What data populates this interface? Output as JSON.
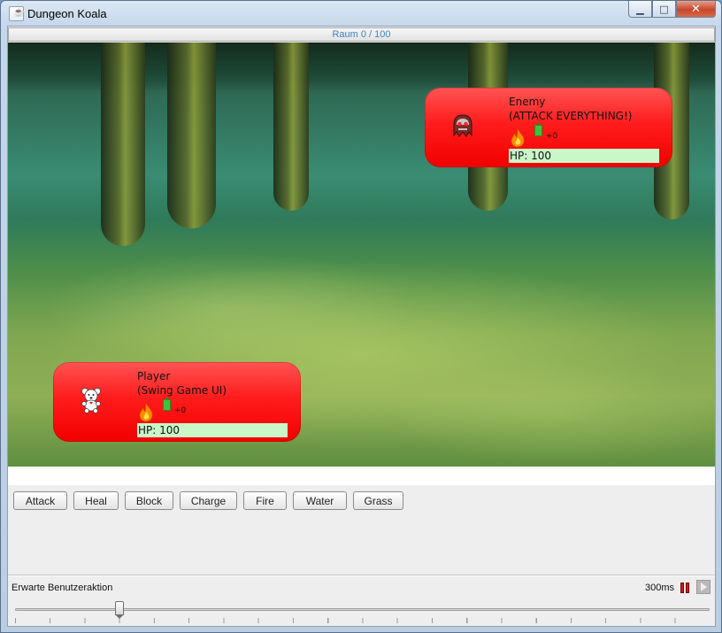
{
  "window": {
    "title": "Dungeon Koala",
    "icon": "java-cup-icon"
  },
  "window_controls": {
    "minimize": "minimize-icon",
    "maximize": "maximize-icon",
    "close": "close-icon"
  },
  "progress": {
    "text": "Raum 0 / 100",
    "value": 0,
    "max": 100
  },
  "enemy": {
    "name": "Enemy",
    "strategy": "(ATTACK EVERYTHING!)",
    "element_icon": "fire-icon",
    "charge_icon": "battery-icon",
    "charge_text": "+0",
    "hp_text": "HP: 100",
    "avatar": "ghost-monster-icon",
    "hp_fraction": 1.0
  },
  "player": {
    "name": "Player",
    "strategy": "(Swing Game UI)",
    "element_icon": "fire-icon",
    "charge_icon": "battery-icon",
    "charge_text": "+0",
    "hp_text": "HP: 100",
    "avatar": "teddy-koala-icon",
    "hp_fraction": 1.0
  },
  "actions": [
    "Attack",
    "Heal",
    "Block",
    "Charge",
    "Fire",
    "Water",
    "Grass"
  ],
  "status": {
    "text": "Erwarte Benutzeraktion",
    "speed": "300ms",
    "pause_icon": "pause-icon",
    "play_icon": "play-icon"
  },
  "slider": {
    "fraction": 0.15
  },
  "colors": {
    "card": "#ff1c1c",
    "hp_bar": "#c8f7c8",
    "accent_text": "#3d82c8"
  }
}
